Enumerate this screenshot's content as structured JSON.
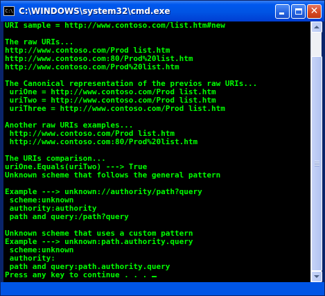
{
  "window": {
    "title": "C:\\WINDOWS\\system32\\cmd.exe",
    "icon_label": "C:\\",
    "icon": "cmd-app-icon",
    "buttons": {
      "minimize": "minimize-icon",
      "maximize": "maximize-icon",
      "close": "close-icon",
      "close_glyph": "✕"
    }
  },
  "console": {
    "foreground": "#00ff00",
    "background": "#000000",
    "lines": [
      "URI sample = http://www.contoso.com/list.htm#new",
      "",
      "The raw URIs...",
      "http://www.contoso.com/Prod list.htm",
      "http://www.contoso.com:80/Prod%20list.htm",
      "http://www.contoso.com/Prod%20list.htm",
      "",
      "The Canonical representation of the previos raw URIs...",
      " uriOne = http://www.contoso.com/Prod list.htm",
      " uriTwo = http://www.contoso.com/Prod list.htm",
      " uriThree = http://www.contoso.com/Prod list.htm",
      "",
      "Another raw URIs examples...",
      " http://www.contoso.com/Prod list.htm",
      " http://www.contoso.com:80/Prod%20list.htm",
      "",
      "The URIs comparison...",
      "uriOne.Equals(uriTwo) ---> True",
      "Unknown scheme that follows the general pattern",
      "",
      "Example ---> unknown://authority/path?query",
      " scheme:unknown",
      " authority:authority",
      " path and query:/path?query",
      "",
      "Unknown scheme that uses a custom pattern",
      "Example ---> unknown:path.authority.query",
      " scheme:unknown",
      " authority:",
      " path and query:path.authority.query"
    ],
    "prompt_line": "Press any key to continue . . . "
  },
  "scrollbar": {
    "up_icon": "scroll-up-arrow-icon",
    "down_icon": "scroll-down-arrow-icon"
  }
}
